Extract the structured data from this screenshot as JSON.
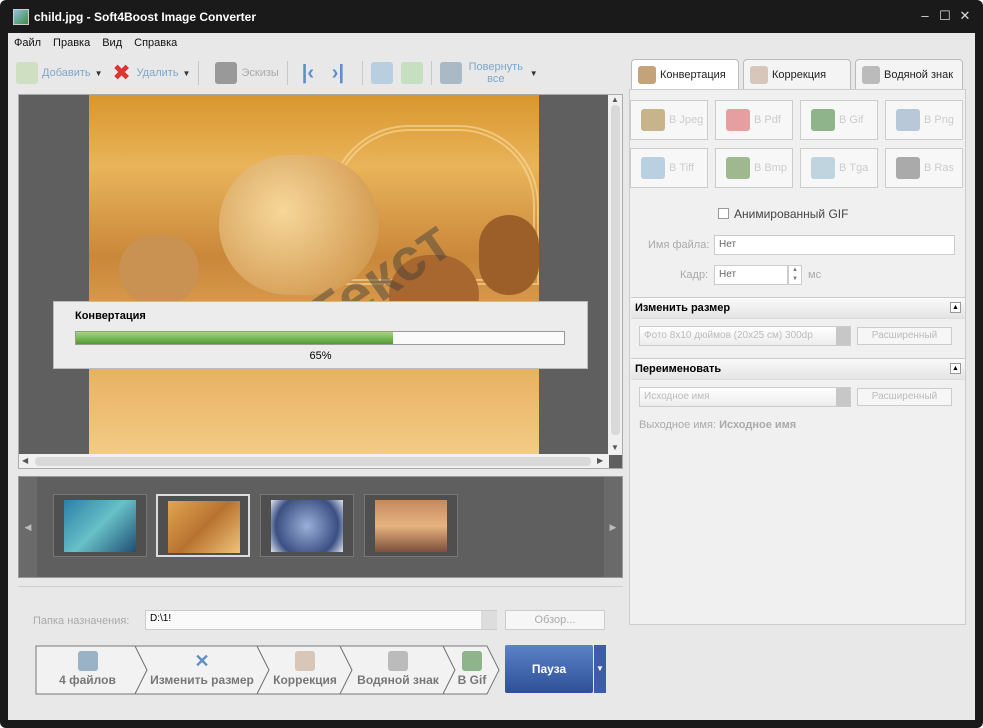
{
  "window": {
    "title": "child.jpg - Soft4Boost Image Converter"
  },
  "menu": [
    "Файл",
    "Правка",
    "Вид",
    "Справка"
  ],
  "toolbar": {
    "add": "Добавить",
    "delete": "Удалить",
    "thumbs": "Эскизы",
    "rotate_all": "Повернуть все"
  },
  "preview": {
    "watermark": "Текст"
  },
  "progress": {
    "title": "Конвертация",
    "percent_label": "65%",
    "value": 0.65
  },
  "tabs": [
    "Конвертация",
    "Коррекция",
    "Водяной знак"
  ],
  "formats": [
    "В Jpeg",
    "В Pdf",
    "В Gif",
    "В Png",
    "В Tiff",
    "В Bmp",
    "В Tga",
    "В Ras"
  ],
  "animated_gif": "Анимированный GIF",
  "file_name": {
    "label": "Имя файла:",
    "value": "Нет"
  },
  "frame": {
    "label": "Кадр:",
    "value": "Нет",
    "unit": "мс"
  },
  "resize": {
    "title": "Изменить размер",
    "preset": "Фото 8x10 дюймов (20x25 см) 300dp",
    "advanced": "Расширенный"
  },
  "rename": {
    "title": "Переименовать",
    "mode": "Исходное имя",
    "advanced": "Расширенный",
    "output_label": "Выходное имя:",
    "output_value": "Исходное имя"
  },
  "destination": {
    "label": "Папка назначения:",
    "value": "D:\\1!",
    "browse": "Обзор..."
  },
  "steps": [
    "4 файлов",
    "Изменить размер",
    "Коррекция",
    "Водяной знак",
    "В Gif"
  ],
  "pause": "Пауза",
  "colors": {
    "accent": "#3a5fa8",
    "progress": "#5aa43a"
  }
}
